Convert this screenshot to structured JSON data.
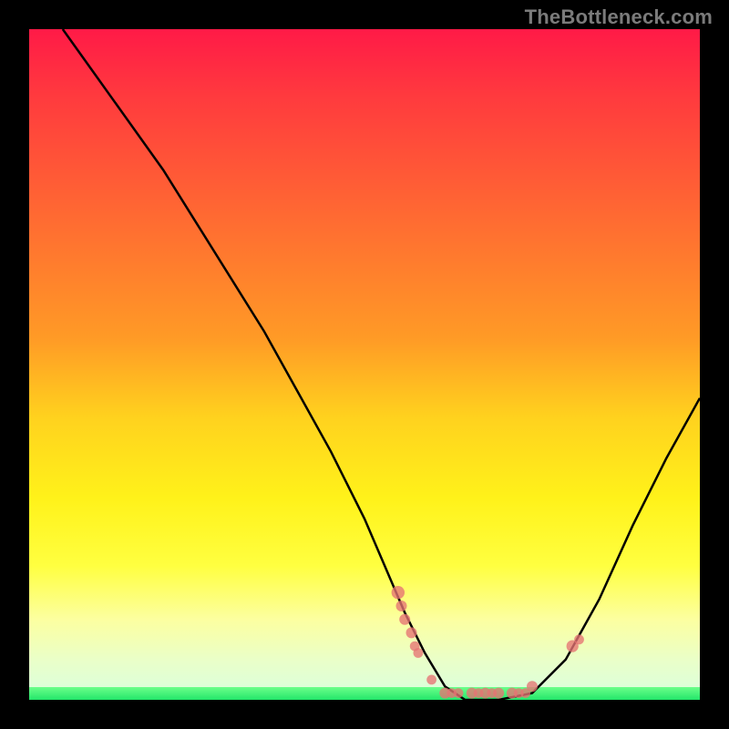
{
  "watermark": "TheBottleneck.com",
  "chart_data": {
    "type": "line",
    "title": "",
    "xlabel": "",
    "ylabel": "",
    "xlim": [
      0,
      100
    ],
    "ylim": [
      0,
      100
    ],
    "grid": false,
    "legend": false,
    "curve_note": "Bottleneck curve: y≈100 at x≈5, descends to y≈0 near x≈62–75, rises to y≈45 at x≈100.",
    "curve_points": [
      {
        "x": 5,
        "y": 100
      },
      {
        "x": 10,
        "y": 93
      },
      {
        "x": 15,
        "y": 86
      },
      {
        "x": 20,
        "y": 79
      },
      {
        "x": 25,
        "y": 71
      },
      {
        "x": 30,
        "y": 63
      },
      {
        "x": 35,
        "y": 55
      },
      {
        "x": 40,
        "y": 46
      },
      {
        "x": 45,
        "y": 37
      },
      {
        "x": 50,
        "y": 27
      },
      {
        "x": 53,
        "y": 20
      },
      {
        "x": 56,
        "y": 13
      },
      {
        "x": 59,
        "y": 7
      },
      {
        "x": 62,
        "y": 2
      },
      {
        "x": 65,
        "y": 0
      },
      {
        "x": 70,
        "y": 0
      },
      {
        "x": 75,
        "y": 1
      },
      {
        "x": 80,
        "y": 6
      },
      {
        "x": 85,
        "y": 15
      },
      {
        "x": 90,
        "y": 26
      },
      {
        "x": 95,
        "y": 36
      },
      {
        "x": 100,
        "y": 45
      }
    ],
    "markers": [
      {
        "x": 55,
        "y": 16,
        "r": 1.2
      },
      {
        "x": 55.5,
        "y": 14,
        "r": 1.0
      },
      {
        "x": 56,
        "y": 12,
        "r": 1.0
      },
      {
        "x": 57,
        "y": 10,
        "r": 1.0
      },
      {
        "x": 57.5,
        "y": 8,
        "r": 0.9
      },
      {
        "x": 58,
        "y": 7,
        "r": 0.9
      },
      {
        "x": 60,
        "y": 3,
        "r": 0.9
      },
      {
        "x": 62,
        "y": 1,
        "r": 1.0
      },
      {
        "x": 63,
        "y": 1,
        "r": 0.9
      },
      {
        "x": 64,
        "y": 1,
        "r": 0.9
      },
      {
        "x": 66,
        "y": 1,
        "r": 1.0
      },
      {
        "x": 67,
        "y": 1,
        "r": 0.9
      },
      {
        "x": 68,
        "y": 1,
        "r": 1.0
      },
      {
        "x": 69,
        "y": 1,
        "r": 0.9
      },
      {
        "x": 70,
        "y": 1,
        "r": 1.0
      },
      {
        "x": 72,
        "y": 1,
        "r": 1.0
      },
      {
        "x": 73,
        "y": 1,
        "r": 0.9
      },
      {
        "x": 74,
        "y": 1,
        "r": 0.9
      },
      {
        "x": 75,
        "y": 2,
        "r": 1.0
      },
      {
        "x": 81,
        "y": 8,
        "r": 1.1
      },
      {
        "x": 82,
        "y": 9,
        "r": 0.9
      }
    ]
  }
}
